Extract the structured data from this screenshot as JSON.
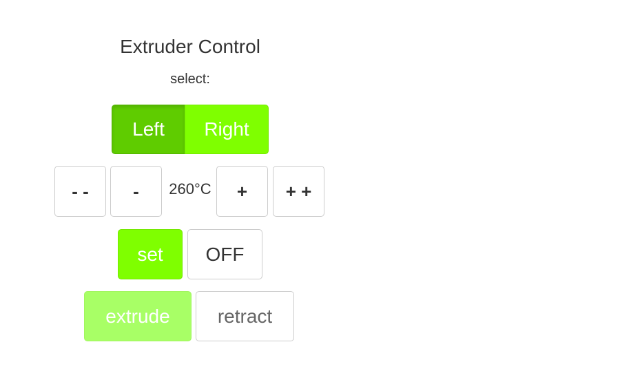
{
  "panel": {
    "title": "Extruder Control",
    "select_label": "select:"
  },
  "extruder_select": {
    "options": [
      "Left",
      "Right"
    ],
    "selected": "Left"
  },
  "temperature": {
    "decrease_large_label": "- -",
    "decrease_label": "-",
    "value": "260°C",
    "increase_label": "+",
    "increase_large_label": "+ +"
  },
  "heater": {
    "set_label": "set",
    "off_label": "OFF"
  },
  "motion": {
    "extrude_label": "extrude",
    "retract_label": "retract",
    "disabled": true
  },
  "colors": {
    "accent_green": "#7fff00",
    "active_green": "#5fcc00",
    "disabled_green": "#a8ff66"
  }
}
